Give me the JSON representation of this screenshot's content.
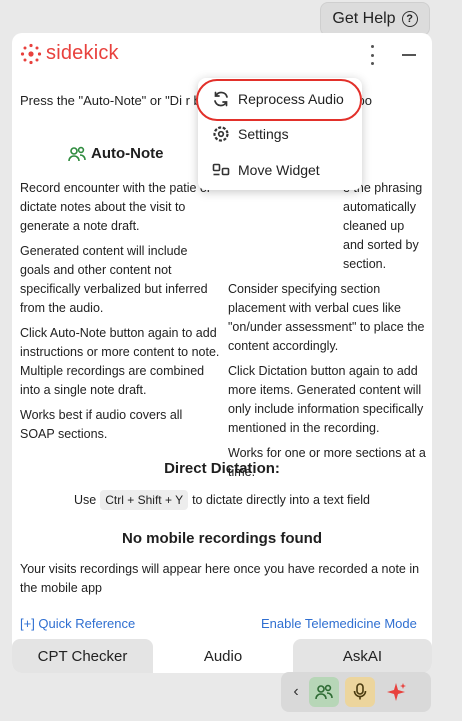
{
  "get_help": {
    "label": "Get Help",
    "icon": "question-circle-icon"
  },
  "header": {
    "logo_text": "sidekick",
    "brand_color": "#e8413d"
  },
  "intro": {
    "text": "Press the \"Auto-Note\" or \"Di                                      r below to record in the correspo"
  },
  "auto_note": {
    "heading": "Auto-Note",
    "paragraphs": [
      "Record encounter with the patie or dictate notes about the visit to generate a note draft.",
      "Generated content will include goals and other content not specifically verbalized but inferred from the audio.",
      "Click Auto-Note button again to add instructions or more content to note. Multiple recordings are combined into a single note draft.",
      "Works best if audio covers all SOAP sections."
    ]
  },
  "dictation_col": {
    "paragraphs": [
      "e the phrasing automatically cleaned up and sorted by section.",
      "Consider specifying section placement with verbal cues like \"on/under assessment\" to place the content accordingly.",
      "Click Dictation button again to add more items. Generated content will only include information specifically mentioned in the recording.",
      "Works for one or more sections at a time."
    ]
  },
  "direct_dictation": {
    "title": "Direct Dictation:",
    "prefix": "Use",
    "shortcut": "Ctrl + Shift + Y",
    "suffix": "to dictate directly into a text field"
  },
  "mobile": {
    "title": "No mobile recordings found",
    "text": "Your visits recordings will appear here once you have recorded a note in the mobile app"
  },
  "links": {
    "quick_reference": "[+] Quick Reference",
    "telemedicine": "Enable Telemedicine Mode",
    "color": "#2f6fd1"
  },
  "tabs": [
    {
      "label": "CPT Checker"
    },
    {
      "label": "Audio"
    },
    {
      "label": "AskAI"
    }
  ],
  "menu": {
    "items": [
      {
        "label": "Reprocess Audio",
        "icon": "refresh-icon"
      },
      {
        "label": "Settings",
        "icon": "gear-icon"
      },
      {
        "label": "Move Widget",
        "icon": "move-widget-icon"
      }
    ],
    "highlight_color": "#e2302a"
  },
  "bottom_bar": {
    "chevron": "‹"
  }
}
